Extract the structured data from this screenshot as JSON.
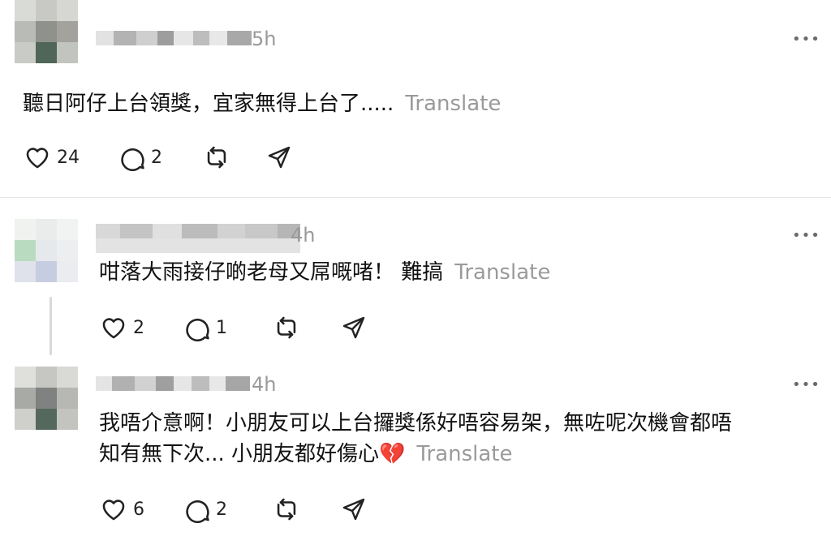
{
  "posts": [
    {
      "time": "5h",
      "text": "聽日阿仔上台領獎，宜家無得上台了.....",
      "translate": "Translate",
      "likes": "24",
      "replies": "2"
    },
    {
      "time": "4h",
      "text": "咁落大雨接仔啲老母又屌嘅啫！ 難搞",
      "translate": "Translate",
      "likes": "2",
      "replies": "1"
    },
    {
      "time": "4h",
      "text_line1": "我唔介意啊！小朋友可以上台攞獎係好唔容易架，無咗呢次機會都唔",
      "text_line2": "知有無下次... 小朋友都好傷心💔",
      "translate": "Translate",
      "likes": "6",
      "replies": "2"
    }
  ],
  "more_label": "•••",
  "colors": {
    "meta_gray": "#999999",
    "divider": "#e4e4e4"
  }
}
